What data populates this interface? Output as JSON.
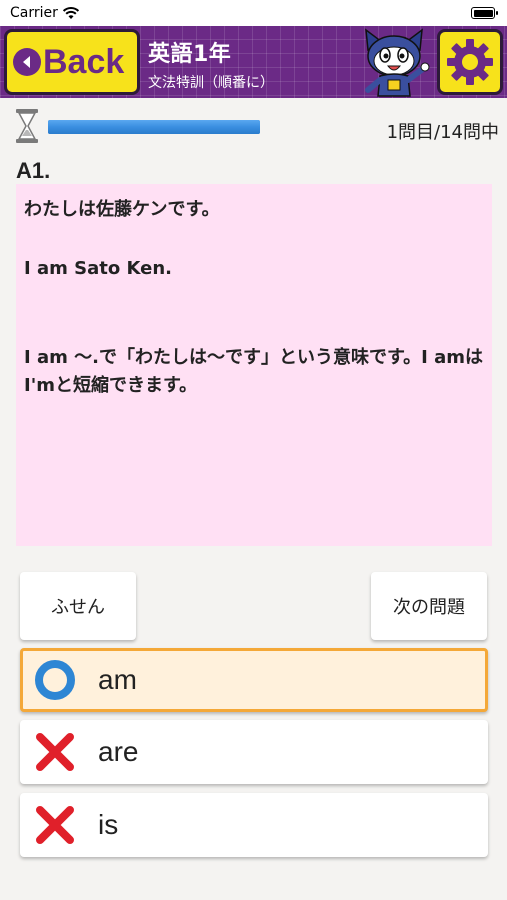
{
  "status_bar": {
    "carrier": "Carrier",
    "time": ""
  },
  "header": {
    "back_label": "Back",
    "title": "英語1年",
    "subtitle": "文法特訓（順番に）",
    "colors": {
      "header_bg": "#6b2a86",
      "button_bg": "#f7e21b"
    }
  },
  "progress": {
    "time_remaining_fraction": 1.0,
    "question_count": "1問目/14問中"
  },
  "question": {
    "label": "A1.",
    "line1": "わたしは佐藤ケンです。",
    "line2": "I am Sato Ken.",
    "line3": "I am 〜.で「わたしは〜です」という意味です。I amはI'mと短縮できます。"
  },
  "buttons": {
    "fusen": "ふせん",
    "next": "次の問題"
  },
  "choices": [
    {
      "text": "am",
      "status": "correct",
      "icon": "circle-icon"
    },
    {
      "text": "are",
      "status": "wrong",
      "icon": "cross-icon"
    },
    {
      "text": "is",
      "status": "wrong",
      "icon": "cross-icon"
    }
  ]
}
